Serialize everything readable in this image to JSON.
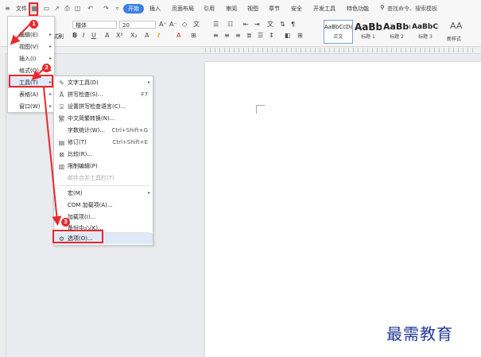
{
  "menubar": {
    "hamburger": "≡",
    "file_menu": "文件",
    "tabs": [
      "开始",
      "插入",
      "页面布局",
      "引用",
      "审阅",
      "视图",
      "章节",
      "安全",
      "开发工具",
      "特色功能"
    ],
    "search_placeholder": "查找命令、搜索模板"
  },
  "ribbon": {
    "font_name": "楷体",
    "font_size": "20",
    "sample_left_label": "试刷",
    "styles": [
      {
        "sample": "AaBbCcDd",
        "label": "正文"
      },
      {
        "sample": "AaBb",
        "label": "标题 1"
      },
      {
        "sample": "AaBb(",
        "label": "标题 2"
      },
      {
        "sample": "AaBbC(",
        "label": "标题 3"
      }
    ],
    "new_style_label": "新样式",
    "text_tools_label": "AA"
  },
  "view_menu": {
    "items": [
      {
        "label": "编辑(E)",
        "has_submenu": true
      },
      {
        "label": "视图(V)",
        "has_submenu": true
      },
      {
        "label": "插入(I)",
        "has_submenu": true
      },
      {
        "label": "格式(O)",
        "has_submenu": true
      },
      {
        "label": "工具(T)",
        "has_submenu": true
      },
      {
        "label": "表格(A)",
        "has_submenu": true
      },
      {
        "label": "窗口(W)",
        "has_submenu": true
      }
    ]
  },
  "tools_submenu": {
    "items": [
      {
        "label": "文字工具(D)",
        "shortcut": "",
        "icon": "text-tools-icon",
        "glyph": "✎",
        "has_submenu": true,
        "disabled": false
      },
      {
        "label": "拼写检查(S)...",
        "shortcut": "F7",
        "icon": "spellcheck-icon",
        "glyph": "Å",
        "has_submenu": false,
        "disabled": false
      },
      {
        "label": "设置拼写检查语言(C)...",
        "shortcut": "",
        "icon": "spell-language-icon",
        "glyph": "⌸",
        "has_submenu": false,
        "disabled": false
      },
      {
        "label": "中文简繁转换(N)...",
        "shortcut": "",
        "icon": "chinese-convert-icon",
        "glyph": "繁",
        "has_submenu": false,
        "disabled": false
      },
      {
        "label": "字数统计(W)...",
        "shortcut": "Ctrl+Shift+G",
        "icon": "",
        "glyph": "",
        "has_submenu": false,
        "disabled": false
      },
      {
        "label": "修订(T)",
        "shortcut": "Ctrl+Shift+E",
        "icon": "track-changes-icon",
        "glyph": "▤",
        "has_submenu": false,
        "disabled": false
      },
      {
        "label": "比较(R)...",
        "shortcut": "",
        "icon": "compare-icon",
        "glyph": "⊠",
        "has_submenu": false,
        "disabled": false
      },
      {
        "label": "限制编辑(P)",
        "shortcut": "",
        "icon": "restrict-edit-icon",
        "glyph": "▥",
        "has_submenu": false,
        "disabled": false
      },
      {
        "label": "邮件合并工具栏(T)",
        "shortcut": "",
        "icon": "",
        "glyph": "",
        "has_submenu": false,
        "disabled": true
      },
      {
        "label": "宏(M)",
        "shortcut": "",
        "icon": "",
        "glyph": "",
        "has_submenu": true,
        "disabled": false
      },
      {
        "label": "COM 加载项(A)...",
        "shortcut": "",
        "icon": "",
        "glyph": "",
        "has_submenu": false,
        "disabled": false
      },
      {
        "label": "加载项(I)...",
        "shortcut": "",
        "icon": "",
        "glyph": "",
        "has_submenu": false,
        "disabled": false
      },
      {
        "label": "备份中心(K)...",
        "shortcut": "",
        "icon": "",
        "glyph": "",
        "has_submenu": false,
        "disabled": false
      },
      {
        "label": "选项(O)...",
        "shortcut": "",
        "icon": "gear-icon",
        "glyph": "⚙",
        "has_submenu": false,
        "disabled": false
      }
    ]
  },
  "annotations": {
    "badges": [
      "1",
      "2",
      "3"
    ],
    "accent_red": "#e8282b"
  },
  "watermark": "最需教育",
  "colors": {
    "start_tab": "#3b7fe5",
    "watermark": "#22389a"
  }
}
